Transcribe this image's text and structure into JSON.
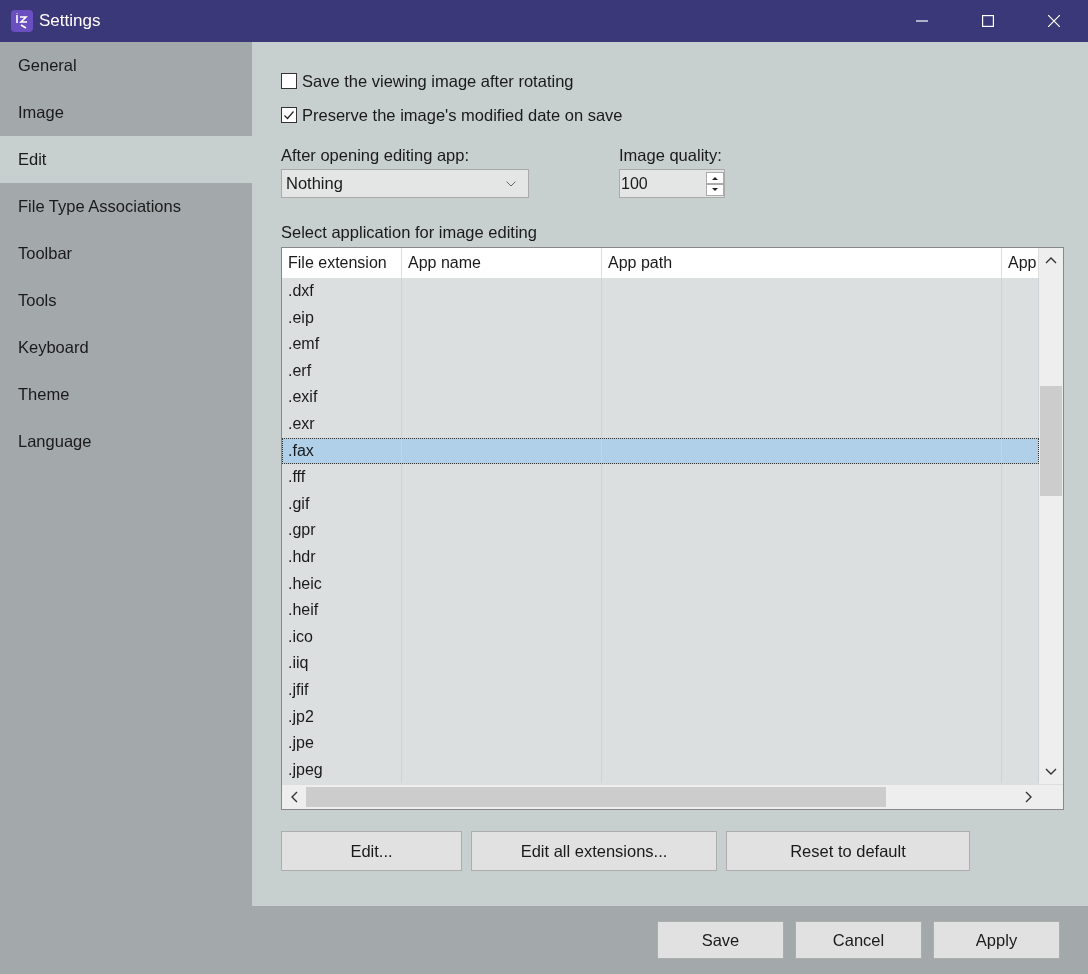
{
  "window": {
    "title": "Settings"
  },
  "sidebar": {
    "items": [
      {
        "label": "General",
        "selected": false
      },
      {
        "label": "Image",
        "selected": false
      },
      {
        "label": "Edit",
        "selected": true
      },
      {
        "label": "File Type Associations",
        "selected": false
      },
      {
        "label": "Toolbar",
        "selected": false
      },
      {
        "label": "Tools",
        "selected": false
      },
      {
        "label": "Keyboard",
        "selected": false
      },
      {
        "label": "Theme",
        "selected": false
      },
      {
        "label": "Language",
        "selected": false
      }
    ]
  },
  "options": [
    {
      "label": "Save the viewing image after rotating",
      "checked": false
    },
    {
      "label": "Preserve the image's modified date on save",
      "checked": true
    }
  ],
  "after_opening": {
    "label": "After opening editing app:",
    "value": "Nothing"
  },
  "image_quality": {
    "label": "Image quality:",
    "value": "100"
  },
  "table": {
    "label": "Select application for image editing",
    "columns": [
      "File extension",
      "App name",
      "App path",
      "App"
    ],
    "rows": [
      {
        "extension": ".dxf",
        "selected": false
      },
      {
        "extension": ".eip",
        "selected": false
      },
      {
        "extension": ".emf",
        "selected": false
      },
      {
        "extension": ".erf",
        "selected": false
      },
      {
        "extension": ".exif",
        "selected": false
      },
      {
        "extension": ".exr",
        "selected": false
      },
      {
        "extension": ".fax",
        "selected": true
      },
      {
        "extension": ".fff",
        "selected": false
      },
      {
        "extension": ".gif",
        "selected": false
      },
      {
        "extension": ".gpr",
        "selected": false
      },
      {
        "extension": ".hdr",
        "selected": false
      },
      {
        "extension": ".heic",
        "selected": false
      },
      {
        "extension": ".heif",
        "selected": false
      },
      {
        "extension": ".ico",
        "selected": false
      },
      {
        "extension": ".iiq",
        "selected": false
      },
      {
        "extension": ".jfif",
        "selected": false
      },
      {
        "extension": ".jp2",
        "selected": false
      },
      {
        "extension": ".jpe",
        "selected": false
      },
      {
        "extension": ".jpeg",
        "selected": false
      }
    ]
  },
  "table_buttons": [
    "Edit...",
    "Edit all extensions...",
    "Reset to default"
  ],
  "footer_buttons": [
    "Save",
    "Cancel",
    "Apply"
  ]
}
